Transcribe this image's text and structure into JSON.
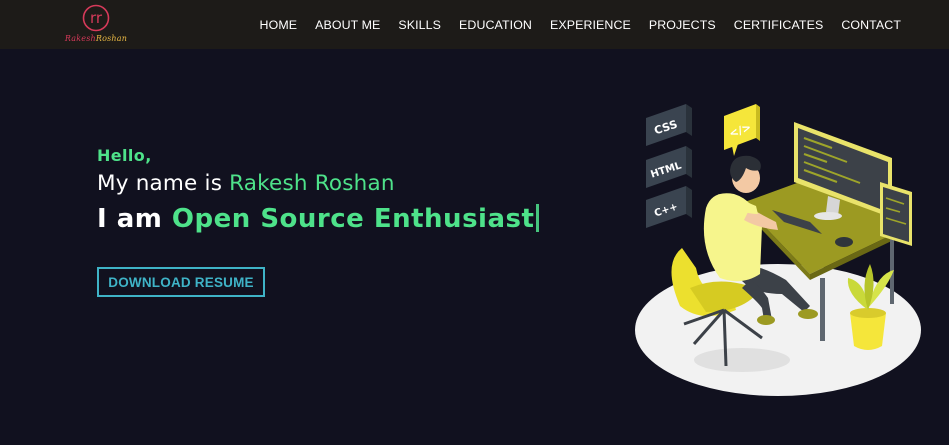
{
  "brand": {
    "logo_initials": "rr",
    "logo_text_first": "Rakesh",
    "logo_text_second": "Roshan"
  },
  "nav": {
    "items": [
      {
        "label": "HOME"
      },
      {
        "label": "ABOUT ME"
      },
      {
        "label": "SKILLS"
      },
      {
        "label": "EDUCATION"
      },
      {
        "label": "EXPERIENCE"
      },
      {
        "label": "PROJECTS"
      },
      {
        "label": "CERTIFICATES"
      },
      {
        "label": "CONTACT"
      }
    ]
  },
  "hero": {
    "greeting": "Hello,",
    "name_prefix": "My name is ",
    "name": "Rakesh Roshan",
    "role_prefix": "I am ",
    "role": "Open Source Enthusiast",
    "resume_button": "DOWNLOAD RESUME"
  },
  "illustration": {
    "tags": [
      "CSS",
      "HTML",
      "C++"
    ],
    "code_bubble": "</>"
  },
  "colors": {
    "background": "#11111f",
    "navbar": "#1d1b18",
    "accent_green": "#4ee28a",
    "button_cyan": "#3fb3c7",
    "logo_red": "#d63a5a",
    "logo_gold": "#e8b844"
  }
}
